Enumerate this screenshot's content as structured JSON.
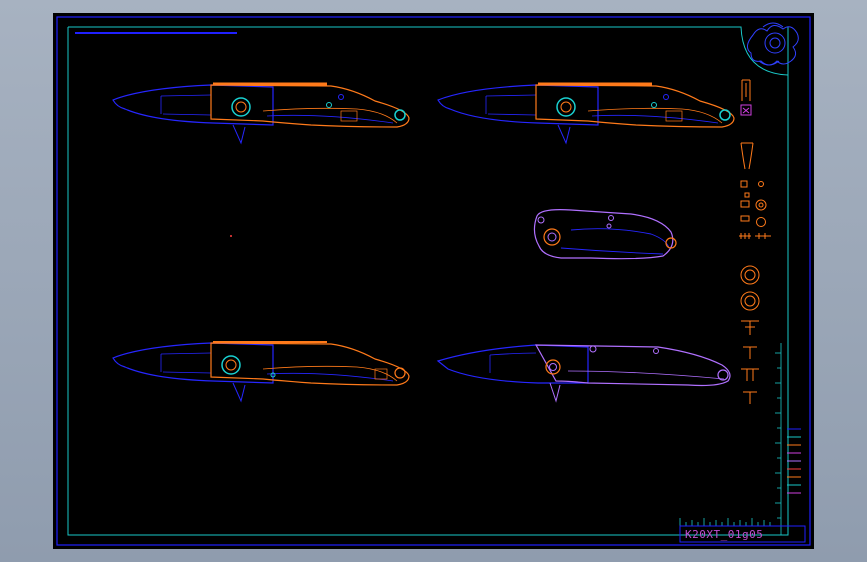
{
  "drawing": {
    "title": "K20XT_01g05"
  },
  "colors": {
    "viewport_bg": "#a7b2c1",
    "sheet_bg": "#000000",
    "frame_outer": "#2020ff",
    "frame_inner": "#19c8c8",
    "blade": "#2626ff",
    "handle_orange": "#ff7a1a",
    "handle_violet": "#b070ff",
    "pivot_cyan": "#19d0d0",
    "magenta": "#d040e0"
  },
  "icons": {
    "logo": "ornamental-crest-icon",
    "parts": "exploded-parts-icon",
    "ruler": "scale-ruler-icon"
  }
}
